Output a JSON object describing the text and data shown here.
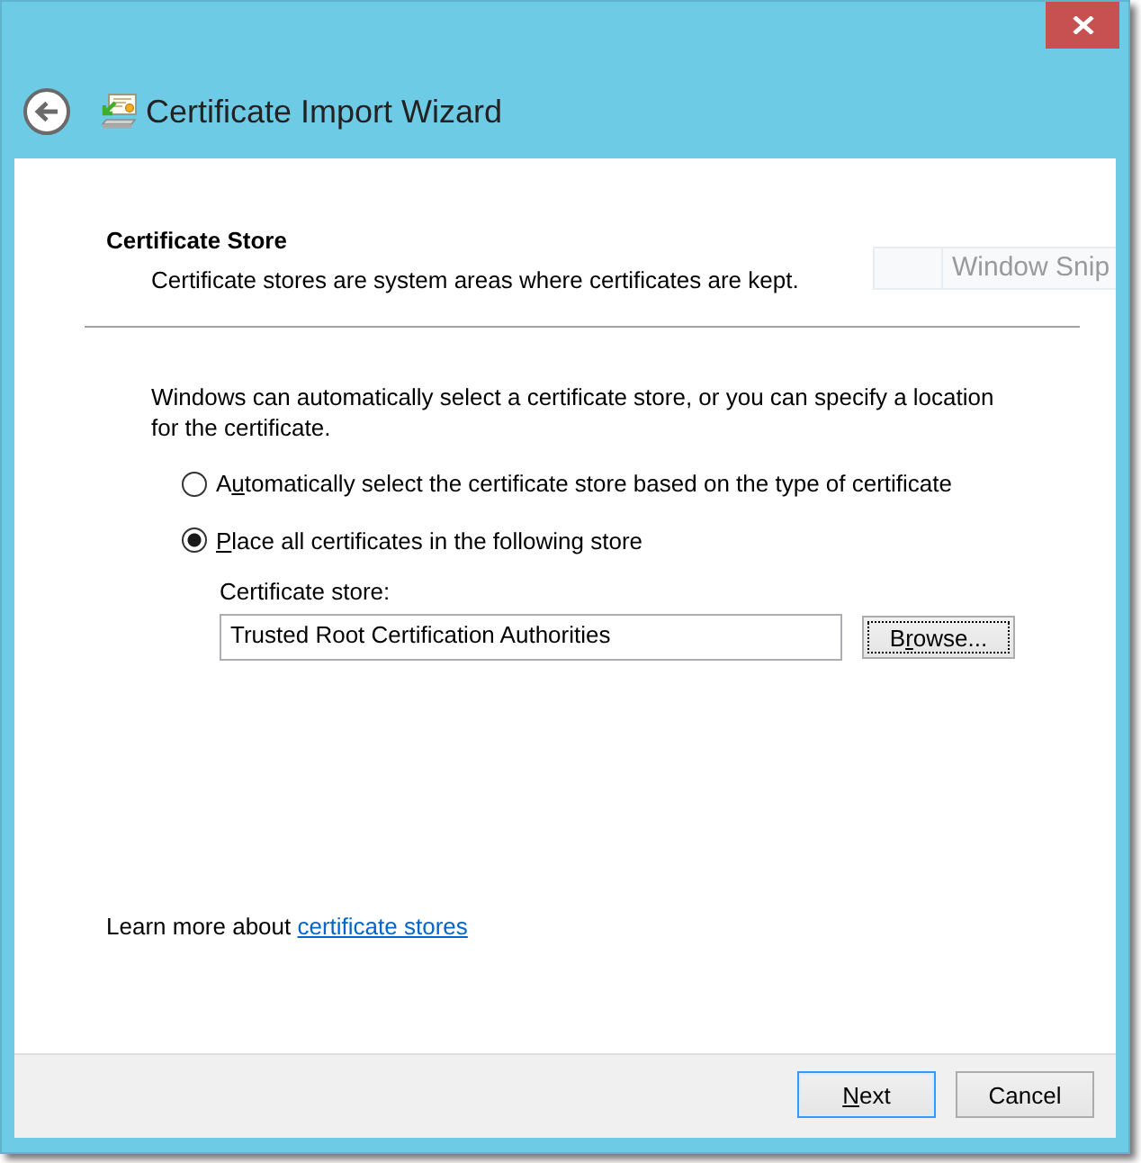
{
  "window": {
    "title": "Certificate Import Wizard"
  },
  "header": {
    "title": "Certificate Store",
    "subtitle": "Certificate stores are system areas where certificates are kept."
  },
  "snip_label": "Window Snip",
  "intro": "Windows can automatically select a certificate store, or you can specify a location for the certificate.",
  "store_options": [
    {
      "label_runs": [
        {
          "text": "A",
          "underlined": false
        },
        {
          "text": "u",
          "underlined": true
        },
        {
          "text": "tomatically select the certificate store based on the type of certificate",
          "underlined": false
        }
      ],
      "selected": false
    },
    {
      "label_runs": [
        {
          "text": "P",
          "underlined": true
        },
        {
          "text": "lace all certificates in the following store",
          "underlined": false
        }
      ],
      "selected": true
    }
  ],
  "store_field": {
    "label": "Certificate store:",
    "value": "Trusted Root Certification Authorities"
  },
  "browse_button": {
    "label_runs": [
      {
        "text": "B",
        "underlined": false
      },
      {
        "text": "r",
        "underlined": true
      },
      {
        "text": "owse...",
        "underlined": false
      }
    ],
    "default": false,
    "focused": true
  },
  "learn_more": {
    "text": "Learn more about",
    "link": "certificate stores"
  },
  "buttons": [
    {
      "label_runs": [
        {
          "text": "N",
          "underlined": true
        },
        {
          "text": "ext",
          "underlined": false
        }
      ],
      "default": true,
      "focused": false
    },
    {
      "label_runs": [
        {
          "text": "Cancel",
          "underlined": false
        }
      ],
      "default": false,
      "focused": false
    }
  ]
}
